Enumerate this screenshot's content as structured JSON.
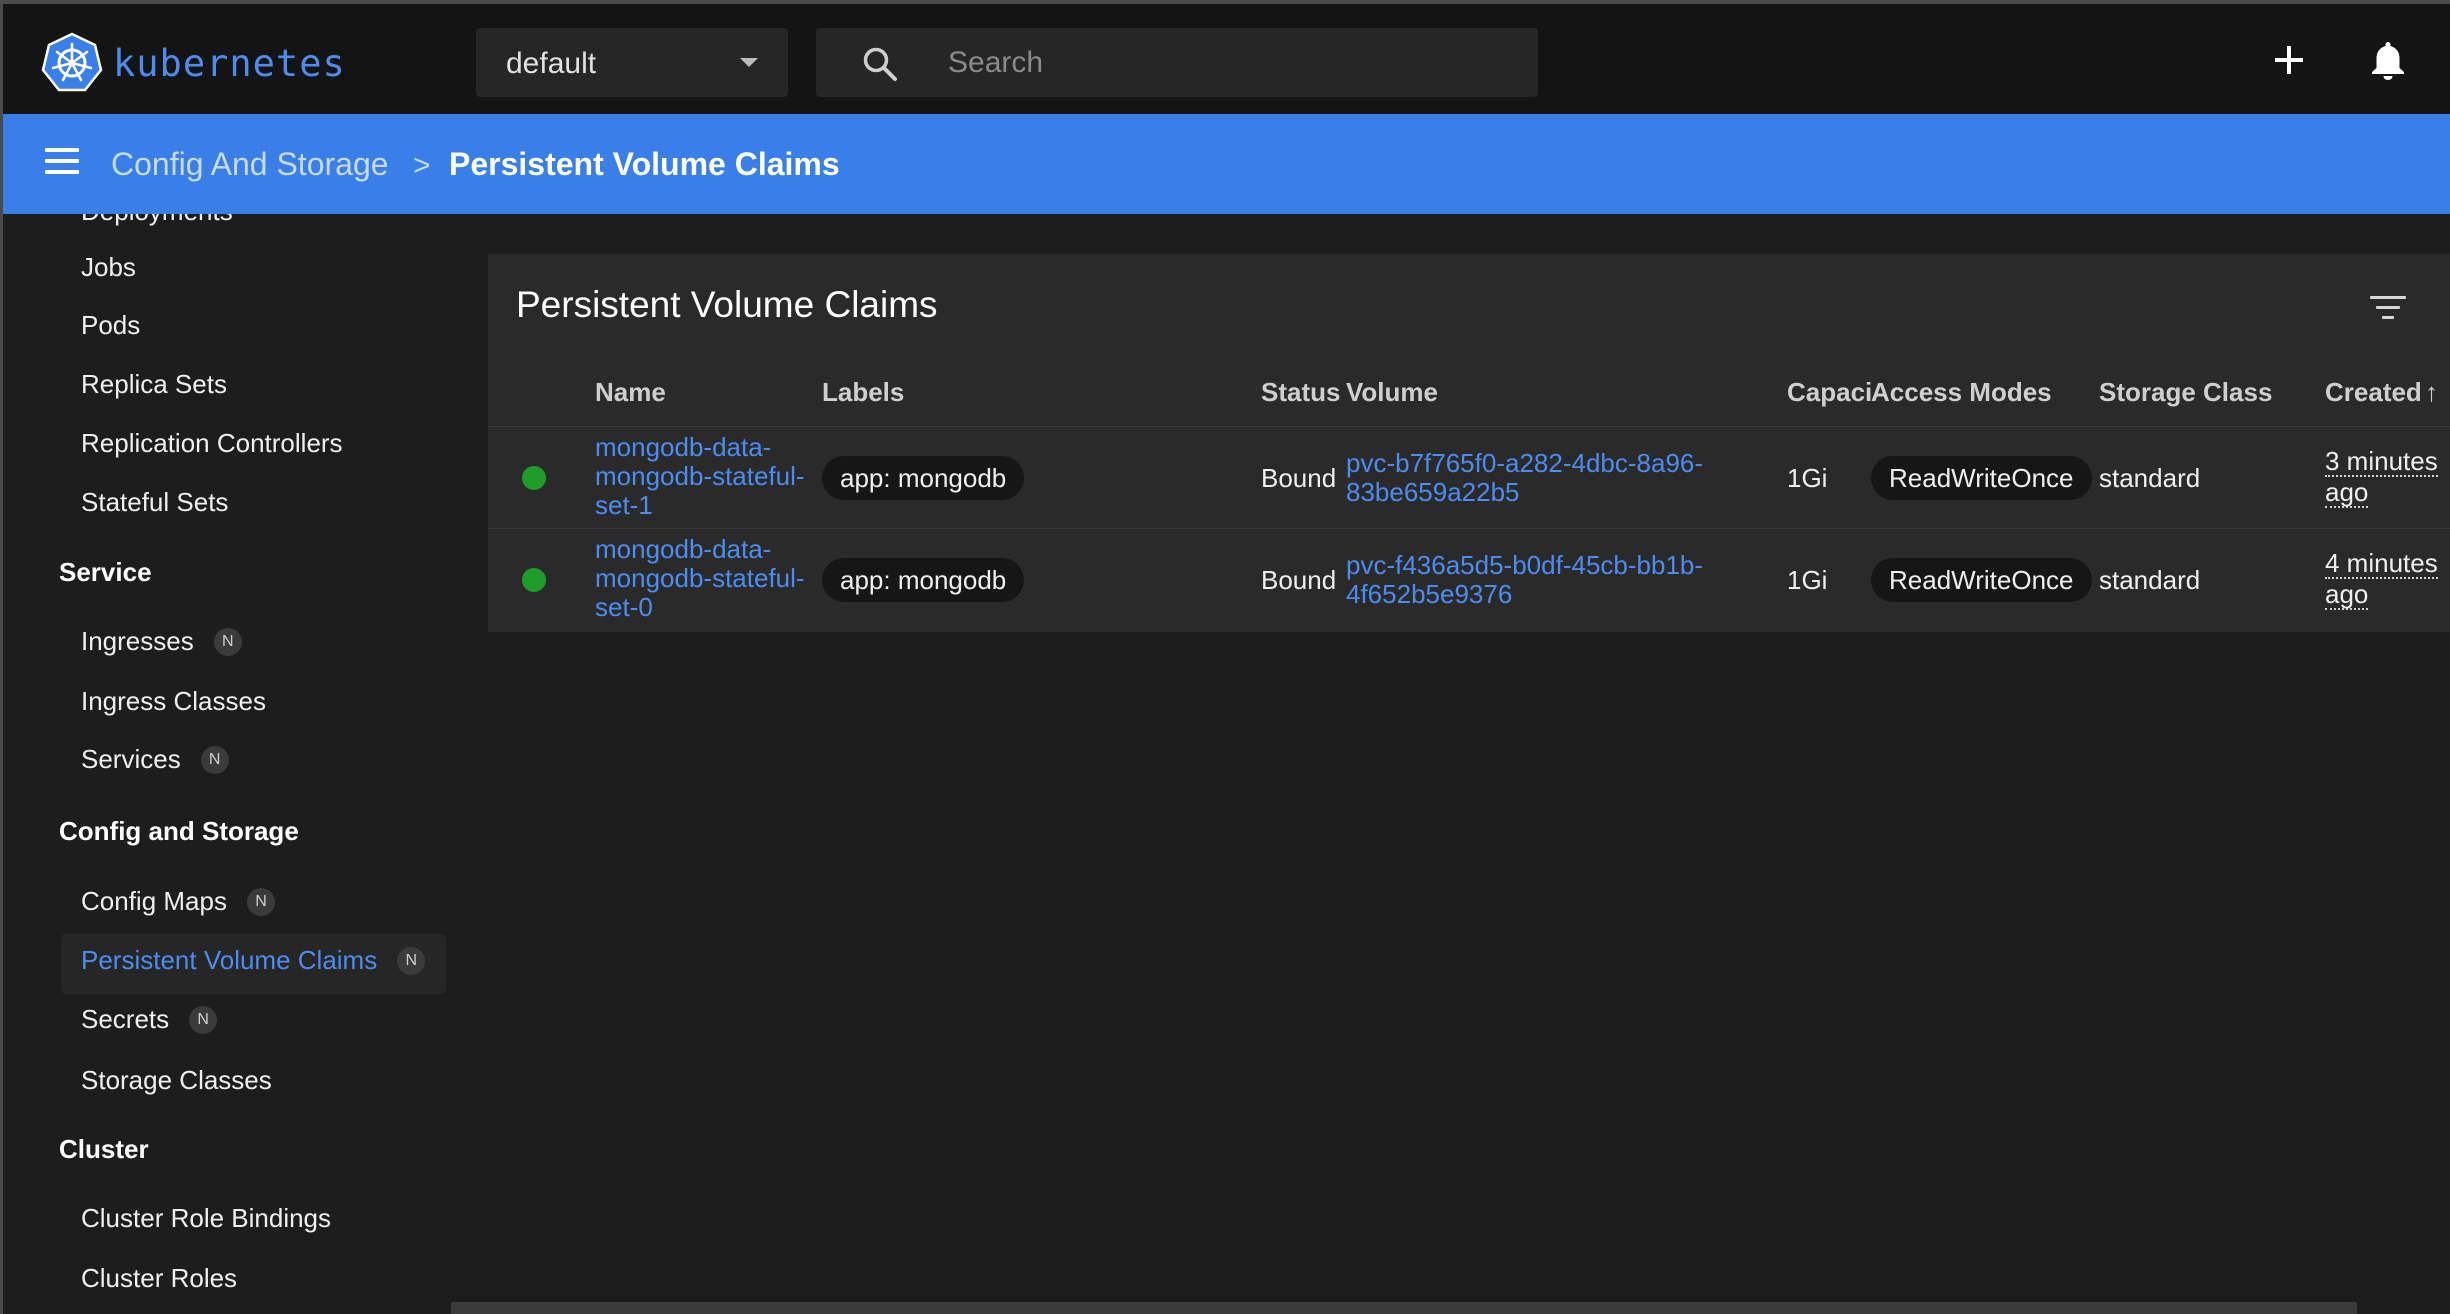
{
  "topbar": {
    "logo_text": "kubernetes",
    "namespace": "default",
    "search_placeholder": "Search"
  },
  "breadcrumb": {
    "parent": "Config And Storage",
    "separator": ">",
    "current": "Persistent Volume Claims"
  },
  "sidebar": {
    "top_cut_label": "Deployments",
    "workloads": [
      "Jobs",
      "Pods",
      "Replica Sets",
      "Replication Controllers",
      "Stateful Sets"
    ],
    "service_header": "Service",
    "service_items": [
      {
        "label": "Ingresses",
        "badge": "N"
      },
      {
        "label": "Ingress Classes",
        "badge": ""
      },
      {
        "label": "Services",
        "badge": "N"
      }
    ],
    "config_header": "Config and Storage",
    "config_items": [
      {
        "label": "Config Maps",
        "badge": "N"
      },
      {
        "label": "Persistent Volume Claims",
        "badge": "N"
      },
      {
        "label": "Secrets",
        "badge": "N"
      },
      {
        "label": "Storage Classes",
        "badge": ""
      }
    ],
    "cluster_header": "Cluster",
    "cluster_items": [
      "Cluster Role Bindings",
      "Cluster Roles"
    ]
  },
  "panel": {
    "title": "Persistent Volume Claims",
    "columns": {
      "name": "Name",
      "labels": "Labels",
      "status": "Status",
      "volume": "Volume",
      "capacity": "Capaci",
      "access_modes": "Access Modes",
      "storage_class": "Storage Class",
      "created": "Created",
      "sort_arrow": "↑"
    },
    "rows": [
      {
        "name": "mongodb-data-mongodb-stateful-set-1",
        "label": "app: mongodb",
        "status": "Bound",
        "volume": "pvc-b7f765f0-a282-4dbc-8a96-83be659a22b5",
        "capacity": "1Gi",
        "access_mode": "ReadWriteOnce",
        "storage_class": "standard",
        "created_line1": "3 minutes",
        "created_line2": "ago"
      },
      {
        "name": "mongodb-data-mongodb-stateful-set-0",
        "label": "app: mongodb",
        "status": "Bound",
        "volume": "pvc-f436a5d5-b0df-45cb-bb1b-4f652b5e9376",
        "capacity": "1Gi",
        "access_mode": "ReadWriteOnce",
        "storage_class": "standard",
        "created_line1": "4 minutes",
        "created_line2": "ago"
      }
    ]
  },
  "colors": {
    "accent": "#3a7ee8",
    "link": "#4d8cf0",
    "status_ok": "#1f9d2a",
    "background": "#1d1d1d",
    "panel": "#2a2a2a"
  }
}
